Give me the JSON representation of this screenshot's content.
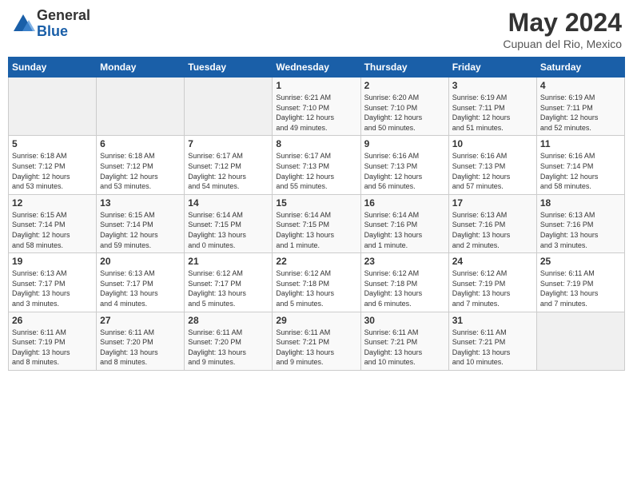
{
  "header": {
    "logo_general": "General",
    "logo_blue": "Blue",
    "month_title": "May 2024",
    "location": "Cupuan del Rio, Mexico"
  },
  "calendar": {
    "days_of_week": [
      "Sunday",
      "Monday",
      "Tuesday",
      "Wednesday",
      "Thursday",
      "Friday",
      "Saturday"
    ],
    "weeks": [
      [
        {
          "day": "",
          "info": ""
        },
        {
          "day": "",
          "info": ""
        },
        {
          "day": "",
          "info": ""
        },
        {
          "day": "1",
          "info": "Sunrise: 6:21 AM\nSunset: 7:10 PM\nDaylight: 12 hours\nand 49 minutes."
        },
        {
          "day": "2",
          "info": "Sunrise: 6:20 AM\nSunset: 7:10 PM\nDaylight: 12 hours\nand 50 minutes."
        },
        {
          "day": "3",
          "info": "Sunrise: 6:19 AM\nSunset: 7:11 PM\nDaylight: 12 hours\nand 51 minutes."
        },
        {
          "day": "4",
          "info": "Sunrise: 6:19 AM\nSunset: 7:11 PM\nDaylight: 12 hours\nand 52 minutes."
        }
      ],
      [
        {
          "day": "5",
          "info": "Sunrise: 6:18 AM\nSunset: 7:12 PM\nDaylight: 12 hours\nand 53 minutes."
        },
        {
          "day": "6",
          "info": "Sunrise: 6:18 AM\nSunset: 7:12 PM\nDaylight: 12 hours\nand 53 minutes."
        },
        {
          "day": "7",
          "info": "Sunrise: 6:17 AM\nSunset: 7:12 PM\nDaylight: 12 hours\nand 54 minutes."
        },
        {
          "day": "8",
          "info": "Sunrise: 6:17 AM\nSunset: 7:13 PM\nDaylight: 12 hours\nand 55 minutes."
        },
        {
          "day": "9",
          "info": "Sunrise: 6:16 AM\nSunset: 7:13 PM\nDaylight: 12 hours\nand 56 minutes."
        },
        {
          "day": "10",
          "info": "Sunrise: 6:16 AM\nSunset: 7:13 PM\nDaylight: 12 hours\nand 57 minutes."
        },
        {
          "day": "11",
          "info": "Sunrise: 6:16 AM\nSunset: 7:14 PM\nDaylight: 12 hours\nand 58 minutes."
        }
      ],
      [
        {
          "day": "12",
          "info": "Sunrise: 6:15 AM\nSunset: 7:14 PM\nDaylight: 12 hours\nand 58 minutes."
        },
        {
          "day": "13",
          "info": "Sunrise: 6:15 AM\nSunset: 7:14 PM\nDaylight: 12 hours\nand 59 minutes."
        },
        {
          "day": "14",
          "info": "Sunrise: 6:14 AM\nSunset: 7:15 PM\nDaylight: 13 hours\nand 0 minutes."
        },
        {
          "day": "15",
          "info": "Sunrise: 6:14 AM\nSunset: 7:15 PM\nDaylight: 13 hours\nand 1 minute."
        },
        {
          "day": "16",
          "info": "Sunrise: 6:14 AM\nSunset: 7:16 PM\nDaylight: 13 hours\nand 1 minute."
        },
        {
          "day": "17",
          "info": "Sunrise: 6:13 AM\nSunset: 7:16 PM\nDaylight: 13 hours\nand 2 minutes."
        },
        {
          "day": "18",
          "info": "Sunrise: 6:13 AM\nSunset: 7:16 PM\nDaylight: 13 hours\nand 3 minutes."
        }
      ],
      [
        {
          "day": "19",
          "info": "Sunrise: 6:13 AM\nSunset: 7:17 PM\nDaylight: 13 hours\nand 3 minutes."
        },
        {
          "day": "20",
          "info": "Sunrise: 6:13 AM\nSunset: 7:17 PM\nDaylight: 13 hours\nand 4 minutes."
        },
        {
          "day": "21",
          "info": "Sunrise: 6:12 AM\nSunset: 7:17 PM\nDaylight: 13 hours\nand 5 minutes."
        },
        {
          "day": "22",
          "info": "Sunrise: 6:12 AM\nSunset: 7:18 PM\nDaylight: 13 hours\nand 5 minutes."
        },
        {
          "day": "23",
          "info": "Sunrise: 6:12 AM\nSunset: 7:18 PM\nDaylight: 13 hours\nand 6 minutes."
        },
        {
          "day": "24",
          "info": "Sunrise: 6:12 AM\nSunset: 7:19 PM\nDaylight: 13 hours\nand 7 minutes."
        },
        {
          "day": "25",
          "info": "Sunrise: 6:11 AM\nSunset: 7:19 PM\nDaylight: 13 hours\nand 7 minutes."
        }
      ],
      [
        {
          "day": "26",
          "info": "Sunrise: 6:11 AM\nSunset: 7:19 PM\nDaylight: 13 hours\nand 8 minutes."
        },
        {
          "day": "27",
          "info": "Sunrise: 6:11 AM\nSunset: 7:20 PM\nDaylight: 13 hours\nand 8 minutes."
        },
        {
          "day": "28",
          "info": "Sunrise: 6:11 AM\nSunset: 7:20 PM\nDaylight: 13 hours\nand 9 minutes."
        },
        {
          "day": "29",
          "info": "Sunrise: 6:11 AM\nSunset: 7:21 PM\nDaylight: 13 hours\nand 9 minutes."
        },
        {
          "day": "30",
          "info": "Sunrise: 6:11 AM\nSunset: 7:21 PM\nDaylight: 13 hours\nand 10 minutes."
        },
        {
          "day": "31",
          "info": "Sunrise: 6:11 AM\nSunset: 7:21 PM\nDaylight: 13 hours\nand 10 minutes."
        },
        {
          "day": "",
          "info": ""
        }
      ]
    ]
  }
}
